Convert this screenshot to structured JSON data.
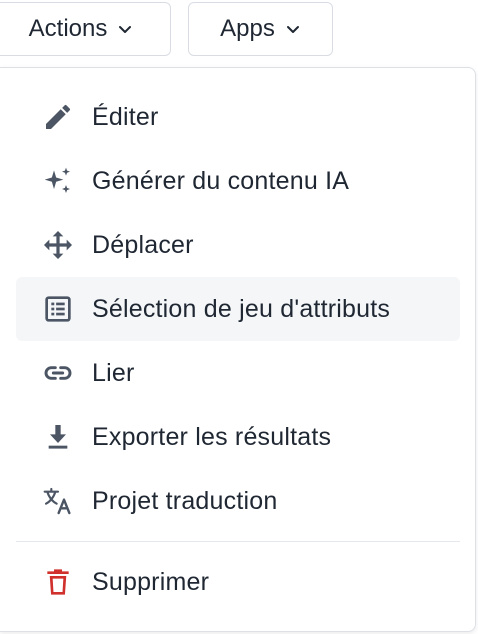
{
  "toolbar": {
    "actions_label": "Actions",
    "apps_label": "Apps"
  },
  "menu": {
    "items": [
      {
        "label": "Éditer",
        "icon": "pencil-icon"
      },
      {
        "label": "Générer du contenu IA",
        "icon": "sparkles-icon"
      },
      {
        "label": "Déplacer",
        "icon": "move-arrows-icon"
      },
      {
        "label": "Sélection de jeu d'attributs",
        "icon": "list-box-icon"
      },
      {
        "label": "Lier",
        "icon": "link-icon"
      },
      {
        "label": "Exporter les résultats",
        "icon": "download-icon"
      },
      {
        "label": "Projet traduction",
        "icon": "translate-icon"
      }
    ],
    "danger_item": {
      "label": "Supprimer",
      "icon": "trash-icon"
    }
  },
  "colors": {
    "text": "#1f2733",
    "icon": "#4b5563",
    "danger": "#d0312d",
    "hover_bg": "#f4f6f8",
    "border": "#d9dde3"
  }
}
